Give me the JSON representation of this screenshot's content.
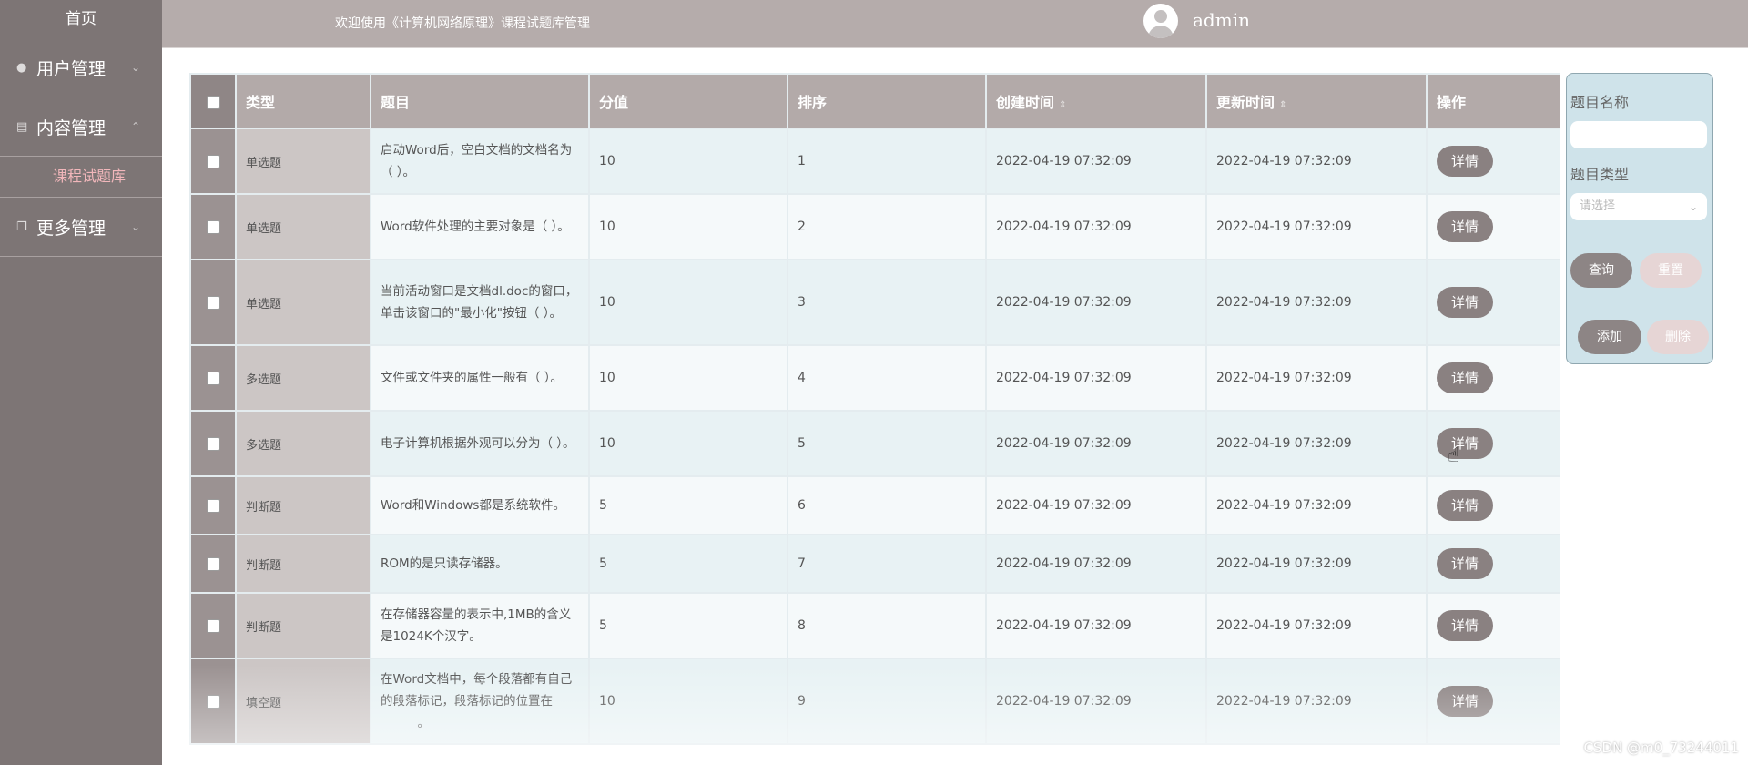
{
  "sidebar": {
    "home": "首页",
    "menus": [
      {
        "label": "用户管理",
        "icon": "user-icon",
        "expanded": false
      },
      {
        "label": "内容管理",
        "icon": "content-icon",
        "expanded": true
      },
      {
        "label": "更多管理",
        "icon": "more-icon",
        "expanded": false
      }
    ],
    "active_sub": "课程试题库"
  },
  "header": {
    "welcome": "欢迎使用《计算机网络原理》课程试题库管理",
    "user": "admin"
  },
  "table": {
    "headers": {
      "type": "类型",
      "question": "题目",
      "score": "分值",
      "order": "排序",
      "created": "创建时间",
      "updated": "更新时间",
      "actions": "操作"
    },
    "detail_label": "详情",
    "rows": [
      {
        "type": "单选题",
        "question": "启动Word后，空白文档的文档名为（      ）。",
        "score": "10",
        "order": "1",
        "created": "2022-04-19 07:32:09",
        "updated": "2022-04-19 07:32:09"
      },
      {
        "type": "单选题",
        "question": "Word软件处理的主要对象是（      ）。",
        "score": "10",
        "order": "2",
        "created": "2022-04-19 07:32:09",
        "updated": "2022-04-19 07:32:09"
      },
      {
        "type": "单选题",
        "question": "当前活动窗口是文档dl.doc的窗口，单击该窗口的\"最小化\"按钮（      ）。",
        "score": "10",
        "order": "3",
        "created": "2022-04-19 07:32:09",
        "updated": "2022-04-19 07:32:09"
      },
      {
        "type": "多选题",
        "question": "文件或文件夹的属性一般有（      ）。",
        "score": "10",
        "order": "4",
        "created": "2022-04-19 07:32:09",
        "updated": "2022-04-19 07:32:09"
      },
      {
        "type": "多选题",
        "question": "电子计算机根据外观可以分为（      ）。",
        "score": "10",
        "order": "5",
        "created": "2022-04-19 07:32:09",
        "updated": "2022-04-19 07:32:09"
      },
      {
        "type": "判断题",
        "question": "Word和Windows都是系统软件。",
        "score": "5",
        "order": "6",
        "created": "2022-04-19 07:32:09",
        "updated": "2022-04-19 07:32:09"
      },
      {
        "type": "判断题",
        "question": "ROM的是只读存储器。",
        "score": "5",
        "order": "7",
        "created": "2022-04-19 07:32:09",
        "updated": "2022-04-19 07:32:09"
      },
      {
        "type": "判断题",
        "question": "在存储器容量的表示中,1MB的含义是1024K个汉字。",
        "score": "5",
        "order": "8",
        "created": "2022-04-19 07:32:09",
        "updated": "2022-04-19 07:32:09"
      },
      {
        "type": "填空题",
        "question": "在Word文档中，每个段落都有自己的段落标记，段落标记的位置在______。",
        "score": "10",
        "order": "9",
        "created": "2022-04-19 07:32:09",
        "updated": "2022-04-19 07:32:09"
      }
    ]
  },
  "search": {
    "name_label": "题目名称",
    "name_value": "",
    "type_label": "题目类型",
    "type_placeholder": "请选择",
    "query_label": "查询",
    "reset_label": "重置",
    "add_label": "添加",
    "delete_label": "删除"
  },
  "watermark": "CSDN @m0_73244011"
}
